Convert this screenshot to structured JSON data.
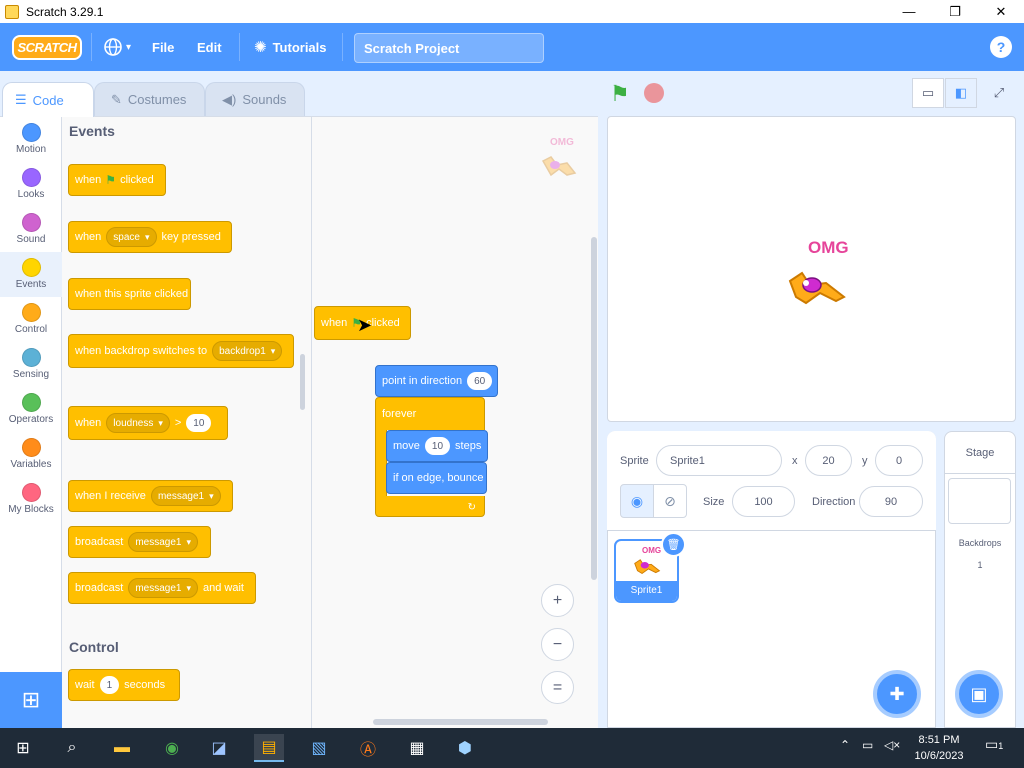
{
  "window": {
    "title": "Scratch 3.29.1",
    "minimize": "—",
    "maximize": "❐",
    "close": "✕"
  },
  "menubar": {
    "logo": "SCRATCH",
    "language_icon": "globe-icon",
    "file": "File",
    "edit": "Edit",
    "tutorials": "Tutorials",
    "project_title": "Scratch Project",
    "help": "?"
  },
  "tabs": {
    "code": "Code",
    "costumes": "Costumes",
    "sounds": "Sounds"
  },
  "categories": [
    {
      "label": "Motion",
      "color": "#4c97ff"
    },
    {
      "label": "Looks",
      "color": "#9966ff"
    },
    {
      "label": "Sound",
      "color": "#cf63cf"
    },
    {
      "label": "Events",
      "color": "#ffd500"
    },
    {
      "label": "Control",
      "color": "#ffab19"
    },
    {
      "label": "Sensing",
      "color": "#5cb1d6"
    },
    {
      "label": "Operators",
      "color": "#59c059"
    },
    {
      "label": "Variables",
      "color": "#ff8c1a"
    },
    {
      "label": "My Blocks",
      "color": "#ff6680"
    }
  ],
  "palette": {
    "events_title": "Events",
    "control_title": "Control",
    "when_flag": {
      "when": "when",
      "clicked": "clicked"
    },
    "when_key": {
      "when": "when",
      "key": "space",
      "pressed": "key pressed"
    },
    "when_sprite": "when this sprite clicked",
    "when_backdrop": {
      "text": "when backdrop switches to",
      "value": "backdrop1"
    },
    "when_loudness": {
      "when": "when",
      "value": "loudness",
      "op": ">",
      "num": "10"
    },
    "when_receive": {
      "text": "when I receive",
      "value": "message1"
    },
    "broadcast": {
      "text": "broadcast",
      "value": "message1"
    },
    "broadcast_wait": {
      "text": "broadcast",
      "value": "message1",
      "suffix": "and wait"
    },
    "wait": {
      "text": "wait",
      "num": "1",
      "suffix": "seconds"
    }
  },
  "script": {
    "hat": {
      "when": "when",
      "clicked": "clicked"
    },
    "point": {
      "text": "point in direction",
      "value": "60"
    },
    "forever": "forever",
    "move": {
      "text": "move",
      "value": "10",
      "suffix": "steps"
    },
    "bounce": "if on edge, bounce",
    "watermark_text": "OMG"
  },
  "zoom": {
    "in": "+",
    "out": "−",
    "reset": "="
  },
  "stage": {
    "omg_text": "OMG"
  },
  "sprite_info": {
    "sprite_label": "Sprite",
    "sprite_name": "Sprite1",
    "x_label": "x",
    "x_value": "20",
    "y_label": "y",
    "y_value": "0",
    "size_label": "Size",
    "size_value": "100",
    "direction_label": "Direction",
    "direction_value": "90"
  },
  "sprites": [
    {
      "name": "Sprite1",
      "thumb_text": "OMG"
    }
  ],
  "stage_pane": {
    "title": "Stage",
    "backdrops_label": "Backdrops",
    "backdrops_count": "1"
  },
  "taskbar": {
    "time": "8:51 PM",
    "date": "10/6/2023",
    "notifications": "1"
  }
}
